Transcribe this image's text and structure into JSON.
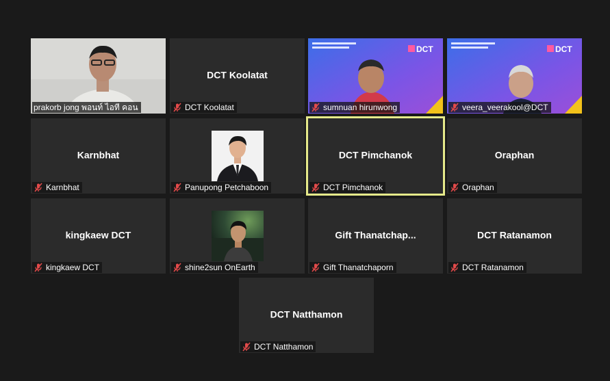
{
  "participants": [
    {
      "name": "prakorb  jong พอนท์ ไอที คอน",
      "display": "",
      "type": "video-gray"
    },
    {
      "name": "DCT Koolatat",
      "display": "DCT Koolatat",
      "type": "name"
    },
    {
      "name": "sumnuan hirunwong",
      "display": "",
      "type": "video-dct"
    },
    {
      "name": "veera_veerakool@DCT",
      "display": "",
      "type": "video-dct"
    },
    {
      "name": "Karnbhat",
      "display": "Karnbhat",
      "type": "name"
    },
    {
      "name": "Panupong Petchaboon",
      "display": "",
      "type": "photo-white"
    },
    {
      "name": "DCT Pimchanok",
      "display": "DCT Pimchanok",
      "type": "name"
    },
    {
      "name": "Oraphan",
      "display": "Oraphan",
      "type": "name"
    },
    {
      "name": "kingkaew DCT",
      "display": "kingkaew DCT",
      "type": "name"
    },
    {
      "name": "shine2sun OnEarth",
      "display": "",
      "type": "photo-night"
    },
    {
      "name": "Gift Thanatchaporn",
      "display": "Gift  Thanatchap...",
      "type": "name"
    },
    {
      "name": "DCT Ratanamon",
      "display": "DCT Ratanamon",
      "type": "name"
    },
    {
      "name": "DCT Natthamon",
      "display": "DCT Natthamon",
      "type": "name"
    }
  ],
  "slide_brand": "DCT",
  "colors": {
    "active_border": "#e6ea8a",
    "mic_muted": "#e24a4a",
    "tile_bg": "#2b2b2b",
    "page_bg": "#1a1a1a"
  }
}
